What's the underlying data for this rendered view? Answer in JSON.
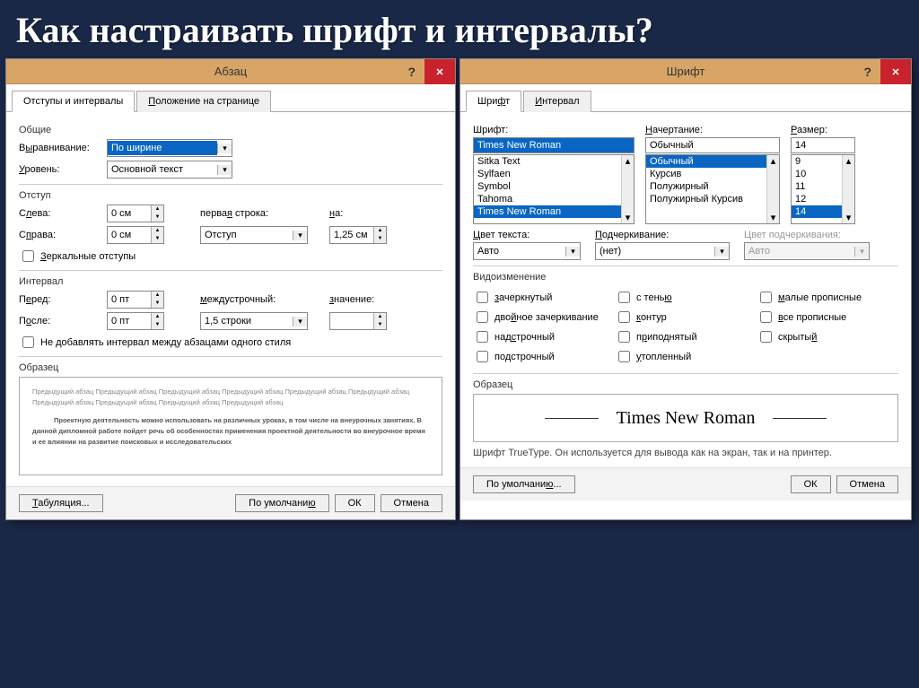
{
  "slide_title": "Как настраивать шрифт и интервалы?",
  "paragraph": {
    "title": "Абзац",
    "tabs": [
      "Отступы и интервалы",
      "Положение на странице"
    ],
    "general": {
      "label": "Общие",
      "align_label": "Выравнивание:",
      "align_value": "По ширине",
      "level_label": "Уровень:",
      "level_value": "Основной текст"
    },
    "indent": {
      "label": "Отступ",
      "left_label": "Слева:",
      "left_value": "0 см",
      "right_label": "Справа:",
      "right_value": "0 см",
      "first_label": "первая строка:",
      "first_value": "Отступ",
      "by_label": "на:",
      "by_value": "1,25 см",
      "mirror_label": "Зеркальные отступы"
    },
    "spacing": {
      "label": "Интервал",
      "before_label": "Перед:",
      "before_value": "0 пт",
      "after_label": "После:",
      "after_value": "0 пт",
      "line_label": "междустрочный:",
      "line_value": "1,5 строки",
      "at_label": "значение:",
      "at_value": "",
      "nosame_label": "Не добавлять интервал между абзацами одного стиля"
    },
    "preview": {
      "label": "Образец",
      "lorem1": "Предыдущий абзац Предыдущий абзац Предыдущий абзац Предыдущий абзац Предыдущий абзац Предыдущий абзац Предыдущий абзац Предыдущий абзац Предыдущий абзац Предыдущий абзац",
      "lorem2": "Проектную деятельность можно использовать на различных уроках, в том числе на внеурочных занятиях. В данной дипломной работе пойдет речь об особенностях применения проектной деятельности во внеурочное время и ее влиянии на развитие поисковых и исследовательских"
    },
    "buttons": {
      "tabs": "Табуляция...",
      "default": "По умолчанию",
      "ok": "ОК",
      "cancel": "Отмена"
    }
  },
  "font": {
    "title": "Шрифт",
    "tabs": [
      "Шрифт",
      "Интервал"
    ],
    "font_label": "Шрифт:",
    "font_value": "Times New Roman",
    "font_list": [
      "Sitka Text",
      "Sylfaen",
      "Symbol",
      "Tahoma",
      "Times New Roman"
    ],
    "style_label": "Начертание:",
    "style_value": "Обычный",
    "style_list": [
      "Обычный",
      "Курсив",
      "Полужирный",
      "Полужирный Курсив"
    ],
    "size_label": "Размер:",
    "size_value": "14",
    "size_list": [
      "9",
      "10",
      "11",
      "12",
      "14"
    ],
    "color_label": "Цвет текста:",
    "color_value": "Авто",
    "underline_label": "Подчеркивание:",
    "underline_value": "(нет)",
    "ucolor_label": "Цвет подчеркивания:",
    "ucolor_value": "Авто",
    "effects_label": "Видоизменение",
    "effects": {
      "c1": [
        "зачеркнутый",
        "двойное зачеркивание",
        "надстрочный",
        "подстрочный"
      ],
      "c2": [
        "с тенью",
        "контур",
        "приподнятый",
        "утопленный"
      ],
      "c3": [
        "малые прописные",
        "все прописные",
        "скрытый"
      ]
    },
    "sample_label": "Образец",
    "sample_text": "Times New Roman",
    "footnote": "Шрифт TrueType. Он используется для вывода как на экран, так и на принтер.",
    "buttons": {
      "default": "По умолчанию...",
      "ok": "ОК",
      "cancel": "Отмена"
    }
  }
}
